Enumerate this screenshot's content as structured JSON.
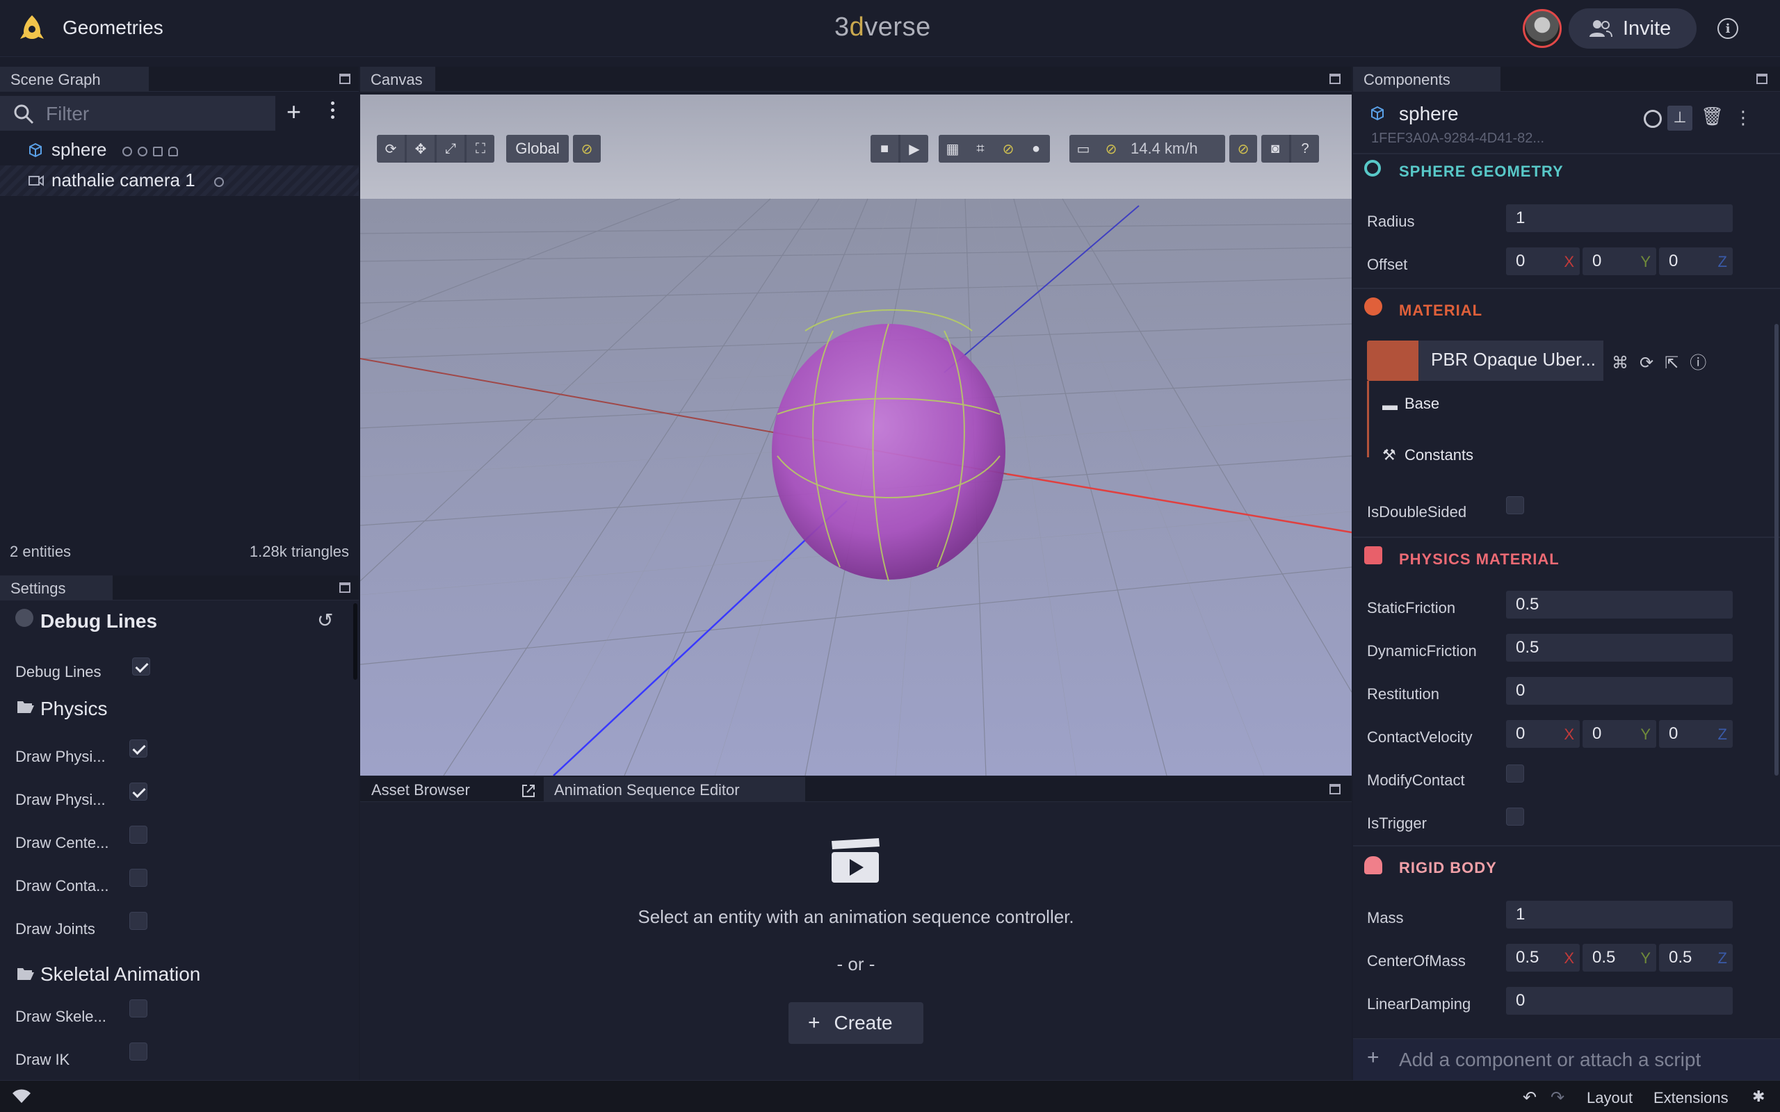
{
  "app": {
    "title": "Geometries",
    "brand_prefix": "3",
    "brand_highlight": "d",
    "brand_suffix": "verse",
    "invite_label": "Invite"
  },
  "scene": {
    "tab_label": "Scene Graph",
    "filter_placeholder": "Filter",
    "entities": [
      {
        "label": "sphere",
        "icon": "cube-icon"
      },
      {
        "label": "nathalie camera 1",
        "icon": "camera-icon"
      }
    ],
    "entity_count": "2 entities",
    "triangle_count": "1.28k triangles"
  },
  "settings": {
    "tab_label": "Settings",
    "debug_title": "Debug Lines",
    "debug_lines_label": "Debug Lines",
    "physics_title": "Physics",
    "physics_items": [
      {
        "label": "Draw Physi...",
        "checked": true
      },
      {
        "label": "Draw Physi...",
        "checked": true
      },
      {
        "label": "Draw Cente...",
        "checked": false
      },
      {
        "label": "Draw Conta...",
        "checked": false
      },
      {
        "label": "Draw Joints",
        "checked": false
      }
    ],
    "skeletal_title": "Skeletal Animation",
    "skeletal_items": [
      {
        "label": "Draw Skele...",
        "checked": false
      },
      {
        "label": "Draw IK",
        "checked": false
      }
    ]
  },
  "canvas": {
    "tab_label": "Canvas",
    "global_label": "Global",
    "speed_label": "14.4 km/h",
    "colors": {
      "sphere": "#b45cc8",
      "x_axis": "#d24040",
      "z_axis": "#3a3aff",
      "sky": "#a9adbd"
    }
  },
  "bottom": {
    "tab_assets": "Asset Browser",
    "tab_animation": "Animation Sequence Editor",
    "empty_message": "Select an entity with an animation sequence controller.",
    "or_label": "- or -",
    "create_label": "Create"
  },
  "components": {
    "tab_label": "Components",
    "entity_name": "sphere",
    "entity_uuid": "1FEF3A0A-9284-4D41-82...",
    "sphere_geometry": {
      "title": "SPHERE GEOMETRY",
      "radius_label": "Radius",
      "radius": "1",
      "offset_label": "Offset",
      "offset": [
        "0",
        "0",
        "0"
      ]
    },
    "material": {
      "title": "MATERIAL",
      "shader": "PBR Opaque Uber...",
      "base_label": "Base",
      "constants_label": "Constants",
      "double_sided_label": "IsDoubleSided"
    },
    "physics_material": {
      "title": "PHYSICS MATERIAL",
      "static_label": "StaticFriction",
      "static": "0.5",
      "dynamic_label": "DynamicFriction",
      "dynamic": "0.5",
      "restitution_label": "Restitution",
      "restitution": "0",
      "contact_velocity_label": "ContactVelocity",
      "contact_velocity": [
        "0",
        "0",
        "0"
      ],
      "modify_contact_label": "ModifyContact",
      "is_trigger_label": "IsTrigger"
    },
    "rigid_body": {
      "title": "RIGID BODY",
      "mass_label": "Mass",
      "mass": "1",
      "com_label": "CenterOfMass",
      "com": [
        "0.5",
        "0.5",
        "0.5"
      ],
      "linear_damping_label": "LinearDamping",
      "linear_damping": "0"
    },
    "add_label": "Add a component or attach a script",
    "axes": [
      "X",
      "Y",
      "Z"
    ]
  },
  "status": {
    "layout_label": "Layout",
    "extensions_label": "Extensions"
  }
}
